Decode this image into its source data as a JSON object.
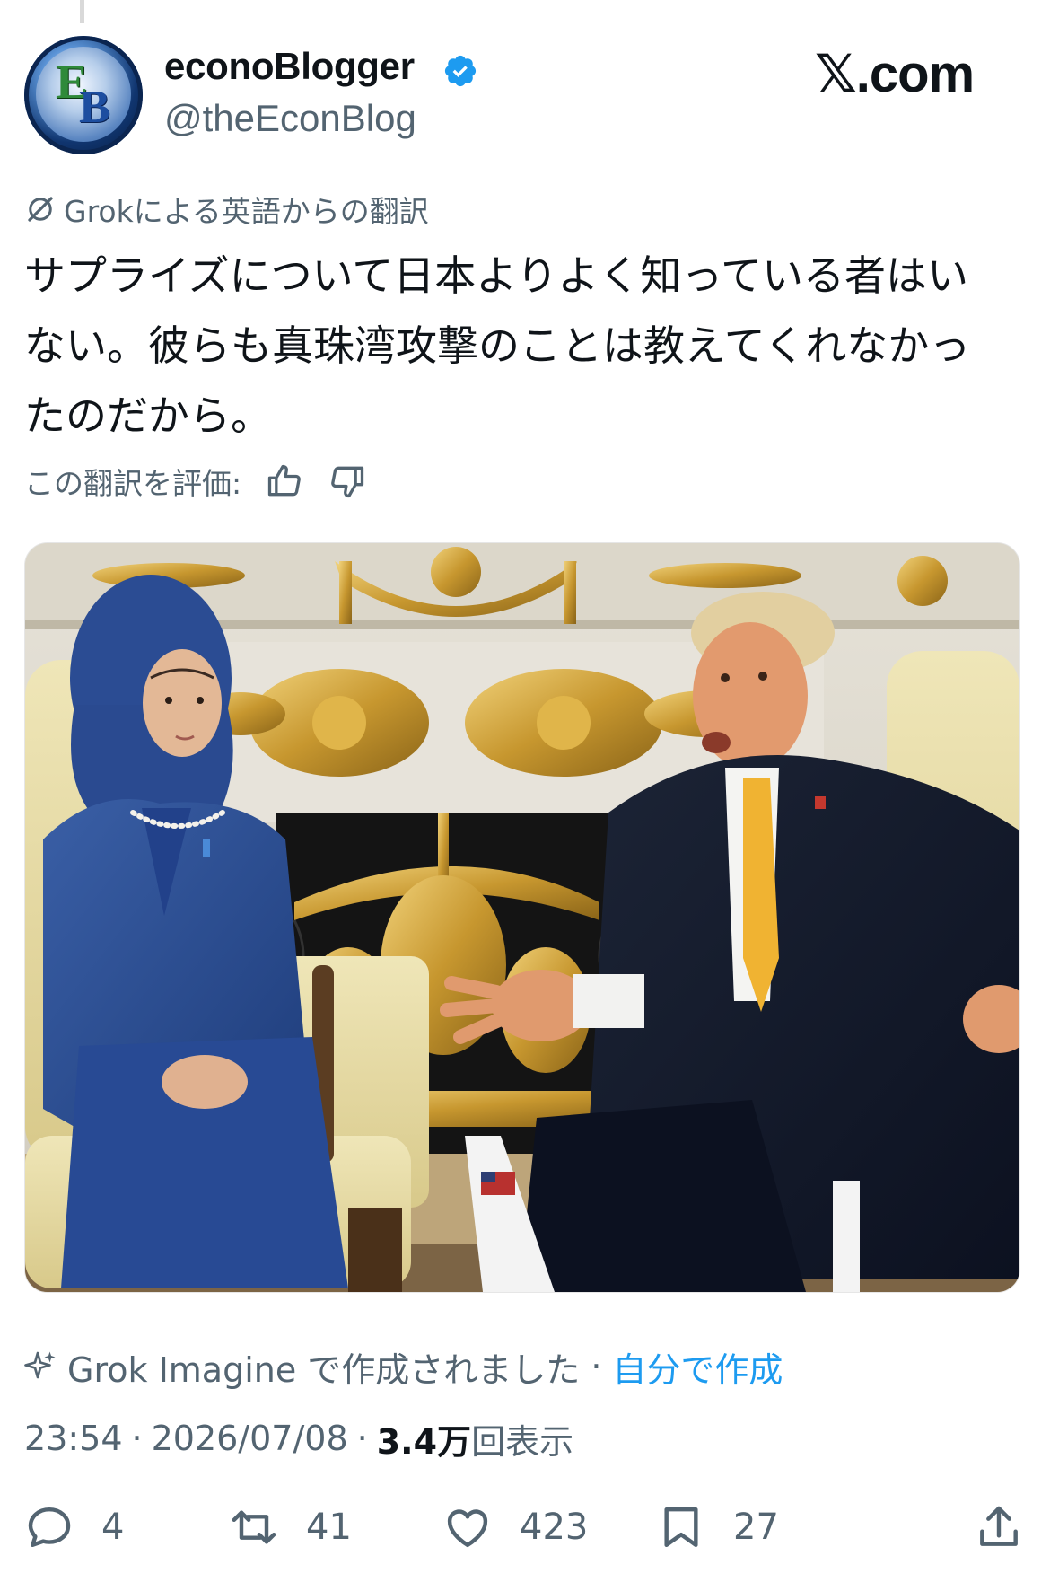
{
  "author": {
    "avatar_text": "EB",
    "name": "econoBlogger",
    "handle": "@theEconBlog",
    "verified": true
  },
  "site_logo": ".com",
  "translation_label": "Grokによる英語からの翻訳",
  "tweet_lines": [
    "サプライズについて日本よりよく知っている者はい",
    "ない。彼らも真珠湾攻撃のことは教えてくれなかっ",
    "たのだから。"
  ],
  "rate_label": "この翻訳を評価:",
  "ai_label": "Grok Imagine で作成されました",
  "ai_separator": "·",
  "ai_link": "自分で作成",
  "time": "23:54",
  "date": "2026/07/08",
  "views_count": "3.4万",
  "views_label": "回表示",
  "meta_separator": "·",
  "actions": {
    "replies": "4",
    "reposts": "41",
    "likes": "423",
    "bookmarks": "27"
  },
  "colors": {
    "accent": "#1d9bf0",
    "text": "#0f1419",
    "secondary": "#536471"
  },
  "icons": [
    "verified-badge-icon",
    "grok-icon",
    "thumbs-up-icon",
    "thumbs-down-icon",
    "sparkle-icon",
    "reply-icon",
    "repost-icon",
    "like-icon",
    "bookmark-icon",
    "share-icon"
  ]
}
